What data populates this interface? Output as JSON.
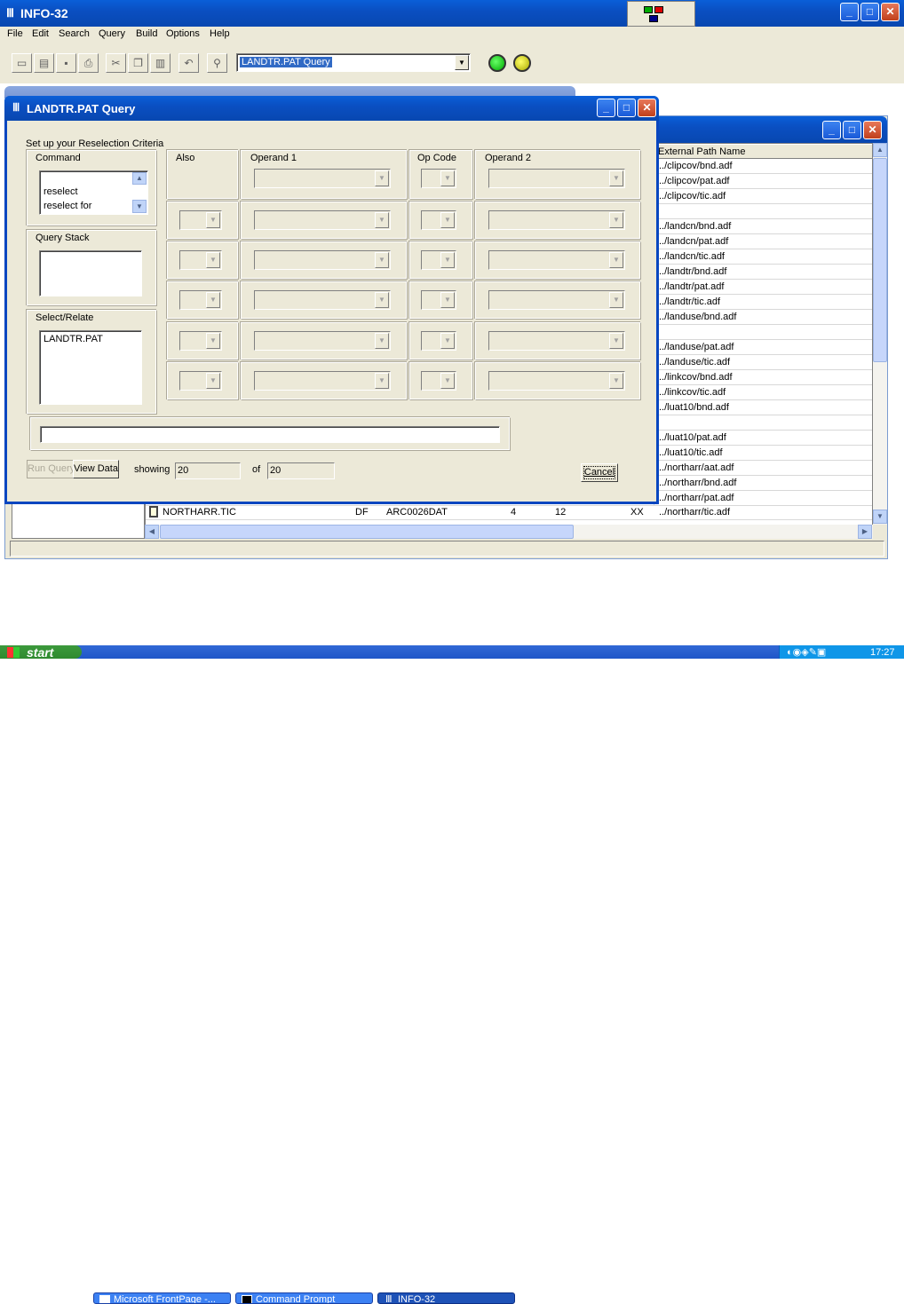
{
  "app": {
    "title": "INFO-32"
  },
  "menu": [
    "File",
    "Edit",
    "Search",
    "Query",
    "Build",
    "Options",
    "Help"
  ],
  "toolbar": {
    "window_select": "LANDTR.PAT Query"
  },
  "dialog": {
    "title": "LANDTR.PAT Query",
    "criteria_label": "Set up your Reselection Criteria",
    "command_label": "Command",
    "command_items": [
      "reselect",
      "reselect for"
    ],
    "query_stack_label": "Query Stack",
    "select_relate_label": "Select/Relate",
    "select_relate_items": [
      "LANDTR.PAT"
    ],
    "headers": {
      "also": "Also",
      "operand1": "Operand 1",
      "opcode": "Op Code",
      "operand2": "Operand 2"
    },
    "run_query": "Run Query",
    "view_data": "View Data",
    "showing_label": "showing",
    "showing_value": "20",
    "of_label": "of",
    "of_value": "20",
    "cancel": "Cancel"
  },
  "file_list": {
    "header": "External Path Name",
    "paths": [
      "../clipcov/bnd.adf",
      "../clipcov/pat.adf",
      "../clipcov/tic.adf",
      "",
      "../landcn/bnd.adf",
      "../landcn/pat.adf",
      "../landcn/tic.adf",
      "../landtr/bnd.adf",
      "../landtr/pat.adf",
      "../landtr/tic.adf",
      "../landuse/bnd.adf",
      "",
      "../landuse/pat.adf",
      "../landuse/tic.adf",
      "../linkcov/bnd.adf",
      "../linkcov/tic.adf",
      "../luat10/bnd.adf",
      "",
      "../luat10/pat.adf",
      "../luat10/tic.adf",
      "../northarr/aat.adf",
      "../northarr/bnd.adf",
      "../northarr/pat.adf"
    ],
    "last_row": {
      "name": "NORTHARR.TIC",
      "type": "DF",
      "id": "ARC0026DAT",
      "c1": "4",
      "c2": "12",
      "c3": "XX",
      "path": "../northarr/tic.adf"
    }
  },
  "taskbar": {
    "start": "start",
    "items": [
      "Microsoft FrontPage -...",
      "Command Prompt",
      "INFO-32"
    ],
    "clock": "17:27"
  }
}
